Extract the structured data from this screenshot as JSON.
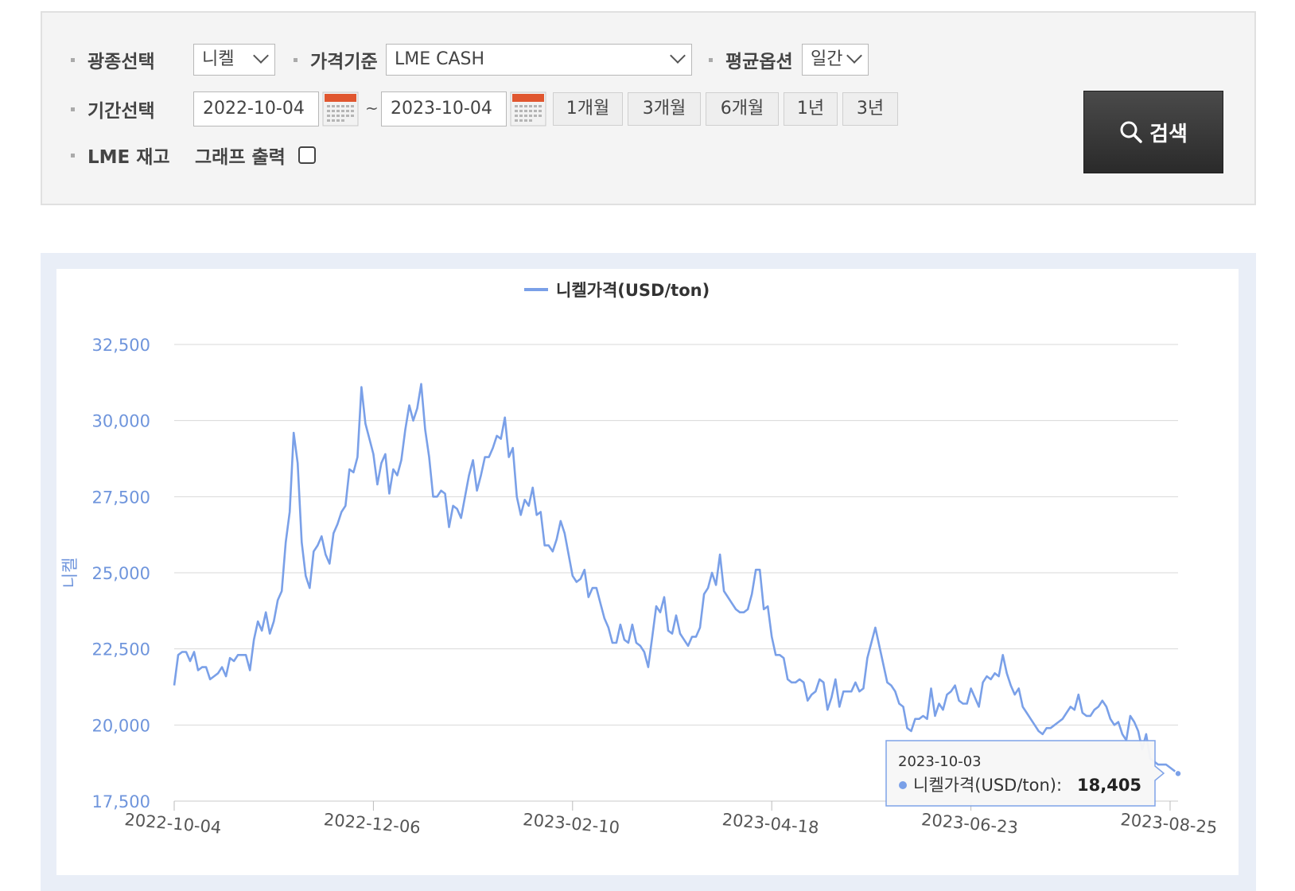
{
  "filters": {
    "mineral_label": "광종선택",
    "mineral_value": "니켈",
    "price_basis_label": "가격기준",
    "price_basis_value": "LME CASH",
    "avg_option_label": "평균옵션",
    "avg_option_value": "일간",
    "period_label": "기간선택",
    "start_date": "2022-10-04",
    "end_date": "2023-10-04",
    "tilde": "~",
    "period_buttons": [
      "1개월",
      "3개월",
      "6개월",
      "1년",
      "3년"
    ],
    "lme_stock_label": "LME 재고",
    "graph_output_label": "그래프 출력",
    "search_button": "검색"
  },
  "tooltip": {
    "date": "2023-10-03",
    "series": "니켈가격(USD/ton):",
    "value": "18,405"
  },
  "chart_data": {
    "type": "line",
    "title": "",
    "xlabel": "",
    "ylabel": "니켈",
    "ylim": [
      17500,
      32500
    ],
    "yticks": [
      "17,500",
      "20,000",
      "22,500",
      "25,000",
      "27,500",
      "30,000",
      "32,500"
    ],
    "xticks": [
      "2022-10-04",
      "2022-12-06",
      "2023-02-10",
      "2023-04-18",
      "2023-06-23",
      "2023-08-25"
    ],
    "legend": "top-center",
    "grid": true,
    "color": "#7aa0e8",
    "series": [
      {
        "name": "니켈가격(USD/ton)",
        "values": [
          21300,
          22300,
          22400,
          22400,
          22100,
          22400,
          21800,
          21900,
          21900,
          21500,
          21600,
          21700,
          21900,
          21600,
          22200,
          22100,
          22300,
          22300,
          22300,
          21800,
          22800,
          23400,
          23100,
          23700,
          23000,
          23400,
          24100,
          24400,
          26000,
          27000,
          29600,
          28600,
          26000,
          24900,
          24500,
          25700,
          25900,
          26200,
          25600,
          25300,
          26300,
          26600,
          27000,
          27200,
          28400,
          28300,
          28800,
          31100,
          29900,
          29400,
          28900,
          27900,
          28600,
          28900,
          27600,
          28400,
          28200,
          28700,
          29700,
          30500,
          30000,
          30400,
          31200,
          29700,
          28800,
          27500,
          27500,
          27700,
          27600,
          26500,
          27200,
          27100,
          26800,
          27500,
          28200,
          28700,
          27700,
          28200,
          28800,
          28800,
          29100,
          29500,
          29400,
          30100,
          28800,
          29100,
          27500,
          26900,
          27400,
          27200,
          27800,
          26900,
          27000,
          25900,
          25900,
          25700,
          26100,
          26700,
          26300,
          25600,
          24900,
          24700,
          24800,
          25100,
          24200,
          24500,
          24500,
          24000,
          23500,
          23200,
          22700,
          22700,
          23300,
          22800,
          22700,
          23300,
          22700,
          22600,
          22400,
          21900,
          22900,
          23900,
          23700,
          24200,
          23100,
          23000,
          23600,
          23000,
          22800,
          22600,
          22900,
          22900,
          23200,
          24300,
          24500,
          25000,
          24600,
          25600,
          24400,
          24200,
          24000,
          23800,
          23700,
          23700,
          23800,
          24300,
          25100,
          25100,
          23800,
          23900,
          22900,
          22300,
          22300,
          22200,
          21500,
          21400,
          21400,
          21500,
          21400,
          20800,
          21000,
          21100,
          21500,
          21400,
          20500,
          20900,
          21500,
          20600,
          21100,
          21100,
          21100,
          21400,
          21100,
          21200,
          22200,
          22700,
          23200,
          22600,
          22000,
          21400,
          21300,
          21100,
          20700,
          20600,
          19900,
          19800,
          20200,
          20200,
          20300,
          20200,
          21200,
          20300,
          20700,
          20500,
          21000,
          21100,
          21300,
          20800,
          20700,
          20700,
          21200,
          20900,
          20600,
          21400,
          21600,
          21500,
          21700,
          21600,
          22300,
          21700,
          21300,
          21000,
          21200,
          20600,
          20400,
          20200,
          20000,
          19800,
          19700,
          19900,
          19900,
          20000,
          20100,
          20200,
          20400,
          20600,
          20500,
          21000,
          20400,
          20300,
          20300,
          20500,
          20600,
          20800,
          20600,
          20200,
          20000,
          20100,
          19700,
          19500,
          20300,
          20100,
          19800,
          19200,
          19700,
          18900,
          18800,
          18700,
          18700,
          18700,
          18600,
          18500,
          18405
        ]
      }
    ]
  }
}
